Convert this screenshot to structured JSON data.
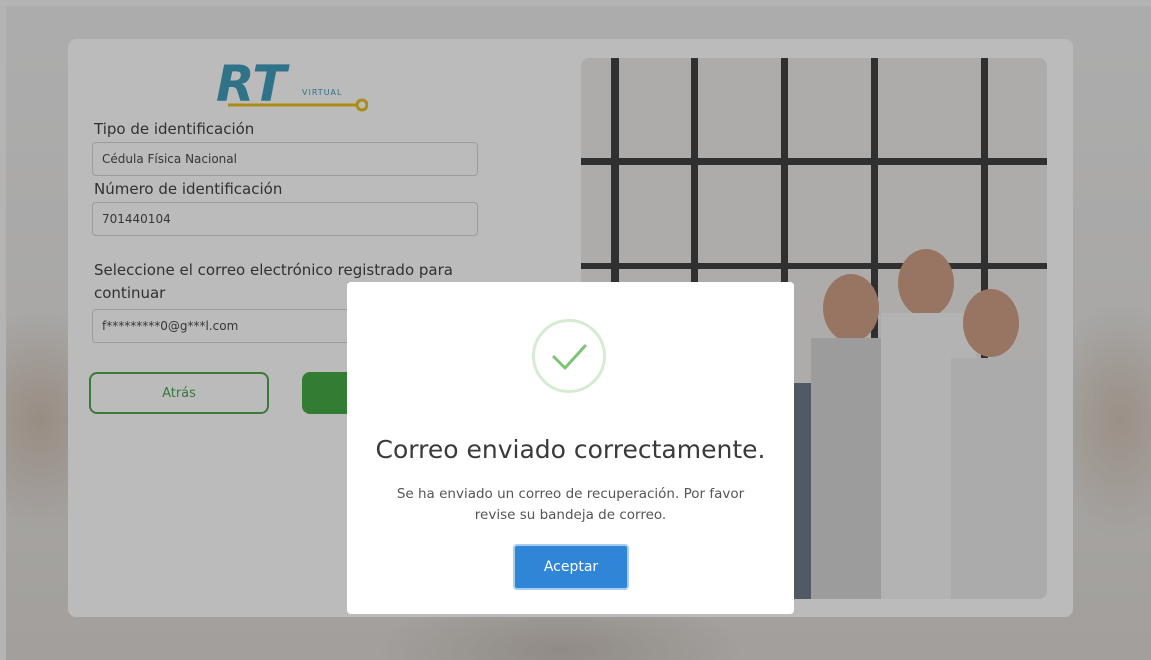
{
  "brand": {
    "logo_letters": "RT",
    "logo_sub": "VIRTUAL",
    "color_primary": "#2a8fb0",
    "color_accent": "#e6b800"
  },
  "form": {
    "id_type_label": "Tipo de identificación",
    "id_type_value": "Cédula Física Nacional",
    "id_number_label": "Número de identificación",
    "id_number_value": "701440104",
    "email_prompt_line1": "Seleccione el correo electrónico registrado para",
    "email_prompt_line2": "continuar",
    "email_value": "f*********0@g***l.com",
    "back_button": "Atrás",
    "color_success": "#2e9e2e"
  },
  "modal": {
    "icon": "check-icon",
    "title": "Correo enviado correctamente.",
    "message_line1": "Se ha enviado un correo de recuperación. Por favor",
    "message_line2": "revise su bandeja de correo.",
    "ok_button": "Aceptar",
    "color_button": "#2f86d6",
    "color_check": "#7cc474"
  }
}
